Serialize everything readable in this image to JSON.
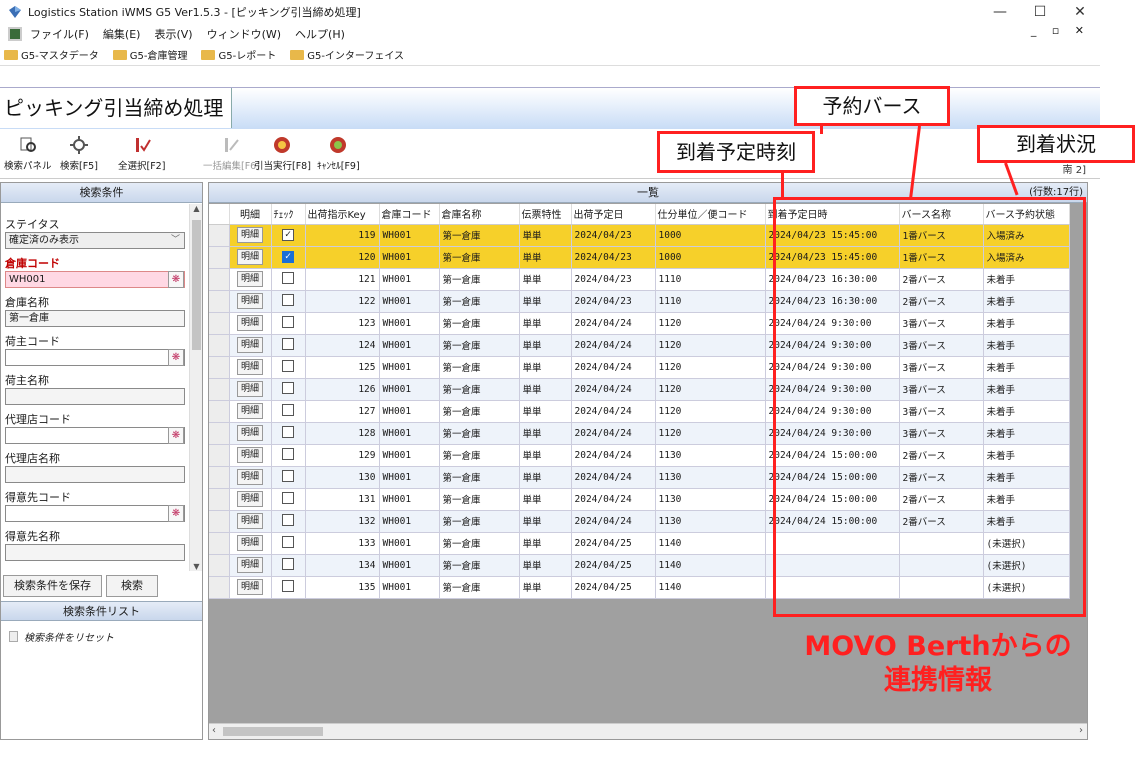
{
  "window": {
    "title": "Logistics Station iWMS G5 Ver1.5.3 - [ピッキング引当締め処理]",
    "controls": [
      "—",
      "☐",
      "✕"
    ]
  },
  "menubar": {
    "items": [
      "ファイル(F)",
      "編集(E)",
      "表示(V)",
      "ウィンドウ(W)",
      "ヘルプ(H)"
    ],
    "mdi_controls": "_ ▫ ✕"
  },
  "favorites": [
    "G5-マスタデータ",
    "G5-倉庫管理",
    "G5-レポート",
    "G5-インターフェイス"
  ],
  "page": {
    "title": "ピッキング引当締め処理"
  },
  "toolbar": {
    "search_panel": "検索パネル",
    "search": "検索[F5]",
    "select_all": "全選択[F2]",
    "bulk_edit": "一括編集[F6]",
    "execute": "引当実行[F8]",
    "cancel": "ｷｬﾝｾﾙ[F9]",
    "status_info": "南 2]"
  },
  "search_panel": {
    "header": "検索条件",
    "status_label": "ステイタス",
    "status_value": "確定済のみ表示",
    "warehouse_code_label": "倉庫コード",
    "warehouse_code_value": "WH001",
    "warehouse_name_label": "倉庫名称",
    "warehouse_name_value": "第一倉庫",
    "owner_code_label": "荷主コード",
    "owner_name_label": "荷主名称",
    "agent_code_label": "代理店コード",
    "agent_name_label": "代理店名称",
    "customer_code_label": "得意先コード",
    "customer_name_label": "得意先名称",
    "save_button": "検索条件を保存",
    "search_button": "検索",
    "list_header": "検索条件リスト",
    "reset_item": "検索条件をリセット"
  },
  "grid": {
    "header": "一覧",
    "row_count": "(行数:17行)",
    "columns": [
      "明細",
      "ﾁｪｯｸ",
      "出荷指示Key",
      "倉庫コード",
      "倉庫名称",
      "伝票特性",
      "出荷予定日",
      "仕分単位／便コード",
      "到着予定日時",
      "バース名称",
      "バース予約状態"
    ],
    "detail_label": "明細",
    "rows": [
      {
        "key": "119",
        "wh_code": "WH001",
        "wh_name": "第一倉庫",
        "slip": "単単",
        "ship_date": "2024/04/23",
        "unit": "1000",
        "arrival": "2024/04/23 15:45:00",
        "berth": "1番バース",
        "status": "入場済み",
        "checked": true,
        "highlight": true,
        "focus": false
      },
      {
        "key": "120",
        "wh_code": "WH001",
        "wh_name": "第一倉庫",
        "slip": "単単",
        "ship_date": "2024/04/23",
        "unit": "1000",
        "arrival": "2024/04/23 15:45:00",
        "berth": "1番バース",
        "status": "入場済み",
        "checked": true,
        "highlight": true,
        "focus": true
      },
      {
        "key": "121",
        "wh_code": "WH001",
        "wh_name": "第一倉庫",
        "slip": "単単",
        "ship_date": "2024/04/23",
        "unit": "1110",
        "arrival": "2024/04/23 16:30:00",
        "berth": "2番バース",
        "status": "未着手",
        "checked": false
      },
      {
        "key": "122",
        "wh_code": "WH001",
        "wh_name": "第一倉庫",
        "slip": "単単",
        "ship_date": "2024/04/23",
        "unit": "1110",
        "arrival": "2024/04/23 16:30:00",
        "berth": "2番バース",
        "status": "未着手",
        "checked": false
      },
      {
        "key": "123",
        "wh_code": "WH001",
        "wh_name": "第一倉庫",
        "slip": "単単",
        "ship_date": "2024/04/24",
        "unit": "1120",
        "arrival": "2024/04/24 9:30:00",
        "berth": "3番バース",
        "status": "未着手",
        "checked": false
      },
      {
        "key": "124",
        "wh_code": "WH001",
        "wh_name": "第一倉庫",
        "slip": "単単",
        "ship_date": "2024/04/24",
        "unit": "1120",
        "arrival": "2024/04/24 9:30:00",
        "berth": "3番バース",
        "status": "未着手",
        "checked": false
      },
      {
        "key": "125",
        "wh_code": "WH001",
        "wh_name": "第一倉庫",
        "slip": "単単",
        "ship_date": "2024/04/24",
        "unit": "1120",
        "arrival": "2024/04/24 9:30:00",
        "berth": "3番バース",
        "status": "未着手",
        "checked": false
      },
      {
        "key": "126",
        "wh_code": "WH001",
        "wh_name": "第一倉庫",
        "slip": "単単",
        "ship_date": "2024/04/24",
        "unit": "1120",
        "arrival": "2024/04/24 9:30:00",
        "berth": "3番バース",
        "status": "未着手",
        "checked": false
      },
      {
        "key": "127",
        "wh_code": "WH001",
        "wh_name": "第一倉庫",
        "slip": "単単",
        "ship_date": "2024/04/24",
        "unit": "1120",
        "arrival": "2024/04/24 9:30:00",
        "berth": "3番バース",
        "status": "未着手",
        "checked": false
      },
      {
        "key": "128",
        "wh_code": "WH001",
        "wh_name": "第一倉庫",
        "slip": "単単",
        "ship_date": "2024/04/24",
        "unit": "1120",
        "arrival": "2024/04/24 9:30:00",
        "berth": "3番バース",
        "status": "未着手",
        "checked": false
      },
      {
        "key": "129",
        "wh_code": "WH001",
        "wh_name": "第一倉庫",
        "slip": "単単",
        "ship_date": "2024/04/24",
        "unit": "1130",
        "arrival": "2024/04/24 15:00:00",
        "berth": "2番バース",
        "status": "未着手",
        "checked": false
      },
      {
        "key": "130",
        "wh_code": "WH001",
        "wh_name": "第一倉庫",
        "slip": "単単",
        "ship_date": "2024/04/24",
        "unit": "1130",
        "arrival": "2024/04/24 15:00:00",
        "berth": "2番バース",
        "status": "未着手",
        "checked": false
      },
      {
        "key": "131",
        "wh_code": "WH001",
        "wh_name": "第一倉庫",
        "slip": "単単",
        "ship_date": "2024/04/24",
        "unit": "1130",
        "arrival": "2024/04/24 15:00:00",
        "berth": "2番バース",
        "status": "未着手",
        "checked": false
      },
      {
        "key": "132",
        "wh_code": "WH001",
        "wh_name": "第一倉庫",
        "slip": "単単",
        "ship_date": "2024/04/24",
        "unit": "1130",
        "arrival": "2024/04/24 15:00:00",
        "berth": "2番バース",
        "status": "未着手",
        "checked": false
      },
      {
        "key": "133",
        "wh_code": "WH001",
        "wh_name": "第一倉庫",
        "slip": "単単",
        "ship_date": "2024/04/25",
        "unit": "1140",
        "arrival": "",
        "berth": "",
        "status": "(未選択)",
        "checked": false
      },
      {
        "key": "134",
        "wh_code": "WH001",
        "wh_name": "第一倉庫",
        "slip": "単単",
        "ship_date": "2024/04/25",
        "unit": "1140",
        "arrival": "",
        "berth": "",
        "status": "(未選択)",
        "checked": false
      },
      {
        "key": "135",
        "wh_code": "WH001",
        "wh_name": "第一倉庫",
        "slip": "単単",
        "ship_date": "2024/04/25",
        "unit": "1140",
        "arrival": "",
        "berth": "",
        "status": "(未選択)",
        "checked": false
      }
    ]
  },
  "annotations": {
    "arrival_time": "到着予定時刻",
    "berth_reservation": "予約バース",
    "arrival_status": "到着状況",
    "caption_line1": "MOVO Berthからの",
    "caption_line2": "連携情報",
    "color": "#ff2020"
  },
  "colors": {
    "highlight_row": "#f6d02a",
    "required_label": "#c00000",
    "accent": "#1a6fd6"
  }
}
